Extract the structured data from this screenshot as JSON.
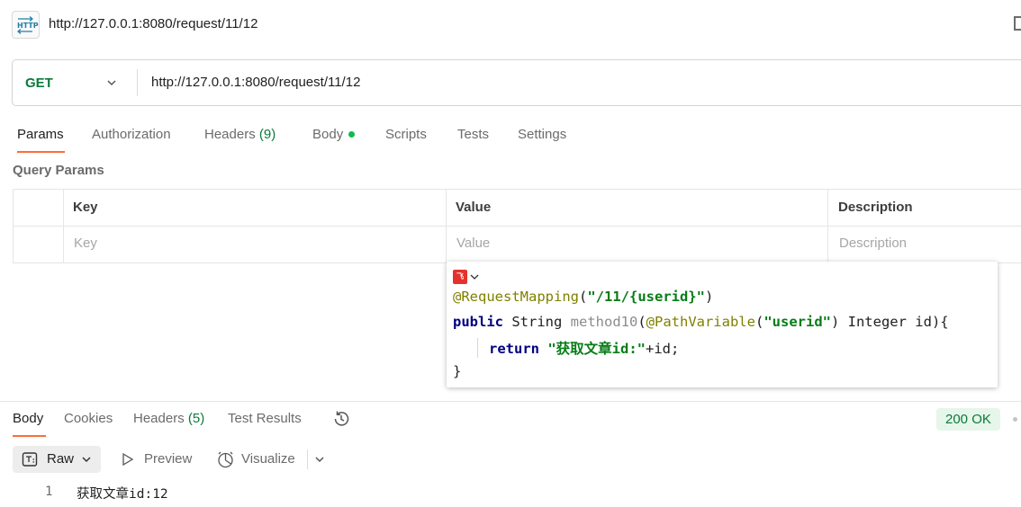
{
  "header": {
    "icon": "http-icon",
    "title": "http://127.0.0.1:8080/request/11/12"
  },
  "request": {
    "method": "GET",
    "url": "http://127.0.0.1:8080/request/11/12"
  },
  "request_tabs": [
    {
      "label": "Params"
    },
    {
      "label": "Authorization"
    },
    {
      "label": "Headers",
      "count": "(9)"
    },
    {
      "label": "Body"
    },
    {
      "label": "Scripts"
    },
    {
      "label": "Tests"
    },
    {
      "label": "Settings"
    }
  ],
  "query_params": {
    "title": "Query Params",
    "columns": [
      "Key",
      "Value",
      "Description"
    ],
    "placeholders": [
      "Key",
      "Value",
      "Description"
    ]
  },
  "code_overlay": {
    "lines": [
      {
        "annotation": "@RequestMapping",
        "open": "(",
        "string": "\"/11/{userid}\"",
        "close": ")"
      },
      {
        "kw": "public",
        "type": " String ",
        "method": "method10",
        "open": "(",
        "annotation": "@PathVariable",
        "open2": "(",
        "string": "\"userid\"",
        "rest": ") Integer id){"
      },
      {
        "kw": "return",
        "string": "\"获取文章id:\"",
        "rest": "+id;"
      },
      {
        "text": "}"
      }
    ]
  },
  "response_tabs": [
    {
      "label": "Body"
    },
    {
      "label": "Cookies"
    },
    {
      "label": "Headers",
      "count": "(5)"
    },
    {
      "label": "Test Results"
    }
  ],
  "status": "200 OK",
  "response_toolbar": {
    "raw": "Raw",
    "preview": "Preview",
    "visualize": "Visualize"
  },
  "response_body": [
    {
      "line": "1",
      "text": "获取文章id:12"
    }
  ],
  "colors": {
    "accent": "#ff6c37",
    "get_method": "#0b7a3b",
    "status_bg": "#e6f6ea"
  }
}
